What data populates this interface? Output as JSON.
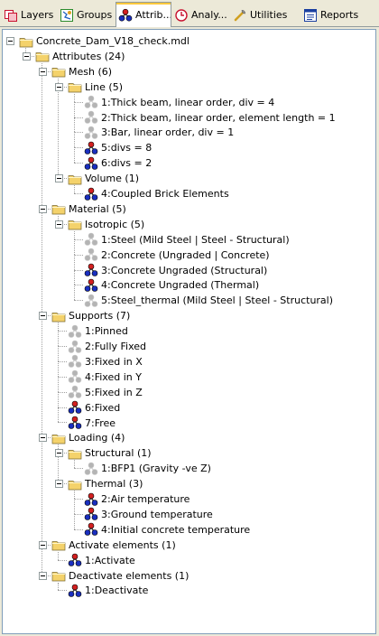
{
  "tabs": [
    {
      "label": "Layers",
      "icon": "layers-icon"
    },
    {
      "label": "Groups",
      "icon": "groups-icon"
    },
    {
      "label": "Attrib...",
      "icon": "attributes-icon",
      "active": true
    },
    {
      "label": "Analy...",
      "icon": "analysis-icon"
    },
    {
      "label": "Utilities",
      "icon": "utilities-icon"
    },
    {
      "label": "Reports",
      "icon": "reports-icon"
    }
  ],
  "tree": [
    {
      "label": "Concrete_Dam_V18_check.mdl",
      "level": 0,
      "icon": "folder",
      "expanded": true
    },
    {
      "label": "Attributes (24)",
      "level": 1,
      "icon": "folder",
      "expanded": true
    },
    {
      "label": "Mesh (6)",
      "level": 2,
      "icon": "folder",
      "expanded": true
    },
    {
      "label": "Line (5)",
      "level": 3,
      "icon": "folder",
      "expanded": true
    },
    {
      "label": "1:Thick beam, linear order, div = 4",
      "level": 4,
      "icon": "attr-grey"
    },
    {
      "label": "2:Thick beam, linear order, element length = 1",
      "level": 4,
      "icon": "attr-grey"
    },
    {
      "label": "3:Bar, linear order, div = 1",
      "level": 4,
      "icon": "attr-grey"
    },
    {
      "label": "5:divs = 8",
      "level": 4,
      "icon": "attr-color"
    },
    {
      "label": "6:divs = 2",
      "level": 4,
      "icon": "attr-color"
    },
    {
      "label": "Volume (1)",
      "level": 3,
      "icon": "folder",
      "expanded": true
    },
    {
      "label": "4:Coupled Brick Elements",
      "level": 4,
      "icon": "attr-color"
    },
    {
      "label": "Material (5)",
      "level": 2,
      "icon": "folder",
      "expanded": true
    },
    {
      "label": "Isotropic (5)",
      "level": 3,
      "icon": "folder",
      "expanded": true
    },
    {
      "label": "1:Steel (Mild Steel | Steel - Structural)",
      "level": 4,
      "icon": "attr-grey"
    },
    {
      "label": "2:Concrete (Ungraded | Concrete)",
      "level": 4,
      "icon": "attr-grey"
    },
    {
      "label": "3:Concrete Ungraded (Structural)",
      "level": 4,
      "icon": "attr-color"
    },
    {
      "label": "4:Concrete Ungraded (Thermal)",
      "level": 4,
      "icon": "attr-color"
    },
    {
      "label": "5:Steel_thermal (Mild Steel | Steel - Structural)",
      "level": 4,
      "icon": "attr-grey"
    },
    {
      "label": "Supports (7)",
      "level": 2,
      "icon": "folder",
      "expanded": true
    },
    {
      "label": "1:Pinned",
      "level": 3,
      "icon": "attr-grey"
    },
    {
      "label": "2:Fully Fixed",
      "level": 3,
      "icon": "attr-grey"
    },
    {
      "label": "3:Fixed in X",
      "level": 3,
      "icon": "attr-grey"
    },
    {
      "label": "4:Fixed in Y",
      "level": 3,
      "icon": "attr-grey"
    },
    {
      "label": "5:Fixed in Z",
      "level": 3,
      "icon": "attr-grey"
    },
    {
      "label": "6:Fixed",
      "level": 3,
      "icon": "attr-color"
    },
    {
      "label": "7:Free",
      "level": 3,
      "icon": "attr-color"
    },
    {
      "label": "Loading (4)",
      "level": 2,
      "icon": "folder",
      "expanded": true
    },
    {
      "label": "Structural (1)",
      "level": 3,
      "icon": "folder",
      "expanded": true
    },
    {
      "label": "1:BFP1 (Gravity -ve Z)",
      "level": 4,
      "icon": "attr-grey"
    },
    {
      "label": "Thermal (3)",
      "level": 3,
      "icon": "folder",
      "expanded": true
    },
    {
      "label": "2:Air temperature",
      "level": 4,
      "icon": "attr-color"
    },
    {
      "label": "3:Ground temperature",
      "level": 4,
      "icon": "attr-color"
    },
    {
      "label": "4:Initial concrete temperature",
      "level": 4,
      "icon": "attr-color"
    },
    {
      "label": "Activate elements (1)",
      "level": 2,
      "icon": "folder",
      "expanded": true
    },
    {
      "label": "1:Activate",
      "level": 3,
      "icon": "attr-color"
    },
    {
      "label": "Deactivate elements (1)",
      "level": 2,
      "icon": "folder",
      "expanded": true
    },
    {
      "label": "1:Deactivate",
      "level": 3,
      "icon": "attr-color"
    }
  ],
  "colors": {
    "tab_active_accent": "#ffc83c",
    "folder": "#f4d26b",
    "attr_red": "#d32020",
    "attr_blue": "#1a2fbf",
    "attr_grey": "#b4b4b4",
    "tree_line": "#a0a0a0"
  }
}
